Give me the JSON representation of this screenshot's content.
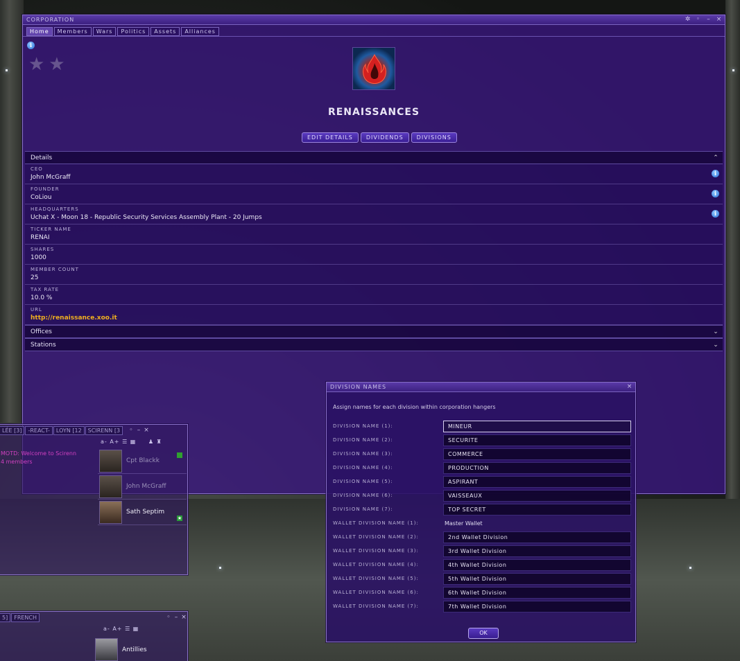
{
  "corp_window": {
    "title": "Corporation",
    "tabs": [
      "Home",
      "Members",
      "Wars",
      "Politics",
      "Assets",
      "Alliances"
    ],
    "corp_name": "RENAISSANCES",
    "actions": {
      "edit": "EDIT DETAILS",
      "dividends": "DIVIDENDS",
      "divisions": "DIVISIONS"
    },
    "details_header": "Details",
    "fields": [
      {
        "label": "CEO",
        "value": "John McGraff"
      },
      {
        "label": "FOUNDER",
        "value": "CoLiou"
      },
      {
        "label": "HEADQUARTERS",
        "value": "Uchat X - Moon 18 - Republic Security Services Assembly Plant - 20 Jumps"
      },
      {
        "label": "TICKER NAME",
        "value": "RENAI"
      },
      {
        "label": "SHARES",
        "value": "1000"
      },
      {
        "label": "MEMBER COUNT",
        "value": "25"
      },
      {
        "label": "TAX RATE",
        "value": "10.0 %"
      },
      {
        "label": "URL",
        "value": "http://renaissance.xoo.it"
      }
    ],
    "offices_header": "Offices",
    "stations_header": "Stations"
  },
  "chat_window": {
    "tabs": [
      "LÉE [3]",
      "-REACT-",
      "LOYN [12",
      "SCIRENN [3"
    ],
    "motd": "MOTD: Welcome to Scirenn",
    "motd2": "4 members",
    "font_tools": "a- A+",
    "members": [
      {
        "name": "Cpt Blackk"
      },
      {
        "name": "John McGraff"
      },
      {
        "name": "Sath Septim"
      }
    ]
  },
  "chat_window_2": {
    "tabs": [
      "5]",
      "FRENCH"
    ],
    "font_tools": "a- A+",
    "member": "Antillies"
  },
  "division_dialog": {
    "title": "Division Names",
    "intro": "Assign names for each division within corporation hangers",
    "divisions": [
      {
        "label": "DIVISION NAME (1):",
        "value": "MINEUR"
      },
      {
        "label": "DIVISION NAME (2):",
        "value": "SECURITE"
      },
      {
        "label": "DIVISION NAME (3):",
        "value": "COMMERCE"
      },
      {
        "label": "DIVISION NAME (4):",
        "value": "PRODUCTION"
      },
      {
        "label": "DIVISION NAME (5):",
        "value": "ASPIRANT"
      },
      {
        "label": "DIVISION NAME (6):",
        "value": "VAISSEAUX"
      },
      {
        "label": "DIVISION NAME (7):",
        "value": "TOP SECRET"
      }
    ],
    "wallets": [
      {
        "label": "WALLET DIVISION NAME (1):",
        "value": "Master Wallet"
      },
      {
        "label": "WALLET DIVISION NAME (2):",
        "value": "2nd Wallet Division"
      },
      {
        "label": "WALLET DIVISION NAME (3):",
        "value": "3rd Wallet Division"
      },
      {
        "label": "WALLET DIVISION NAME (4):",
        "value": "4th Wallet Division"
      },
      {
        "label": "WALLET DIVISION NAME (5):",
        "value": "5th Wallet Division"
      },
      {
        "label": "WALLET DIVISION NAME (6):",
        "value": "6th Wallet Division"
      },
      {
        "label": "WALLET DIVISION NAME (7):",
        "value": "7th Wallet Division"
      }
    ],
    "ok": "OK"
  },
  "colors": {
    "window_bg": "#3a1680",
    "link": "#f0b020",
    "motd": "#d040c0",
    "border": "#8a72c8"
  }
}
